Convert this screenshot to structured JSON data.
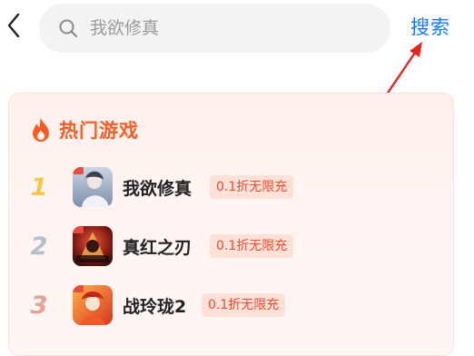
{
  "search": {
    "placeholder": "我欲修真",
    "button_label": "搜索"
  },
  "hot_section": {
    "title": "热门游戏",
    "accent_color": "#fa5c23",
    "games": [
      {
        "rank": "1",
        "name": "我欲修真",
        "tag": "0.1折无限充",
        "icon": "game-woyuxiuzhen-icon"
      },
      {
        "rank": "2",
        "name": "真红之刃",
        "tag": "0.1折无限充",
        "icon": "game-zhenhongzhiren-icon"
      },
      {
        "rank": "3",
        "name": "战玲珑2",
        "tag": "0.1折无限充",
        "icon": "game-zhanlinglong2-icon"
      }
    ]
  },
  "colors": {
    "link_blue": "#1677ff",
    "annotation_red": "#e8231b"
  }
}
